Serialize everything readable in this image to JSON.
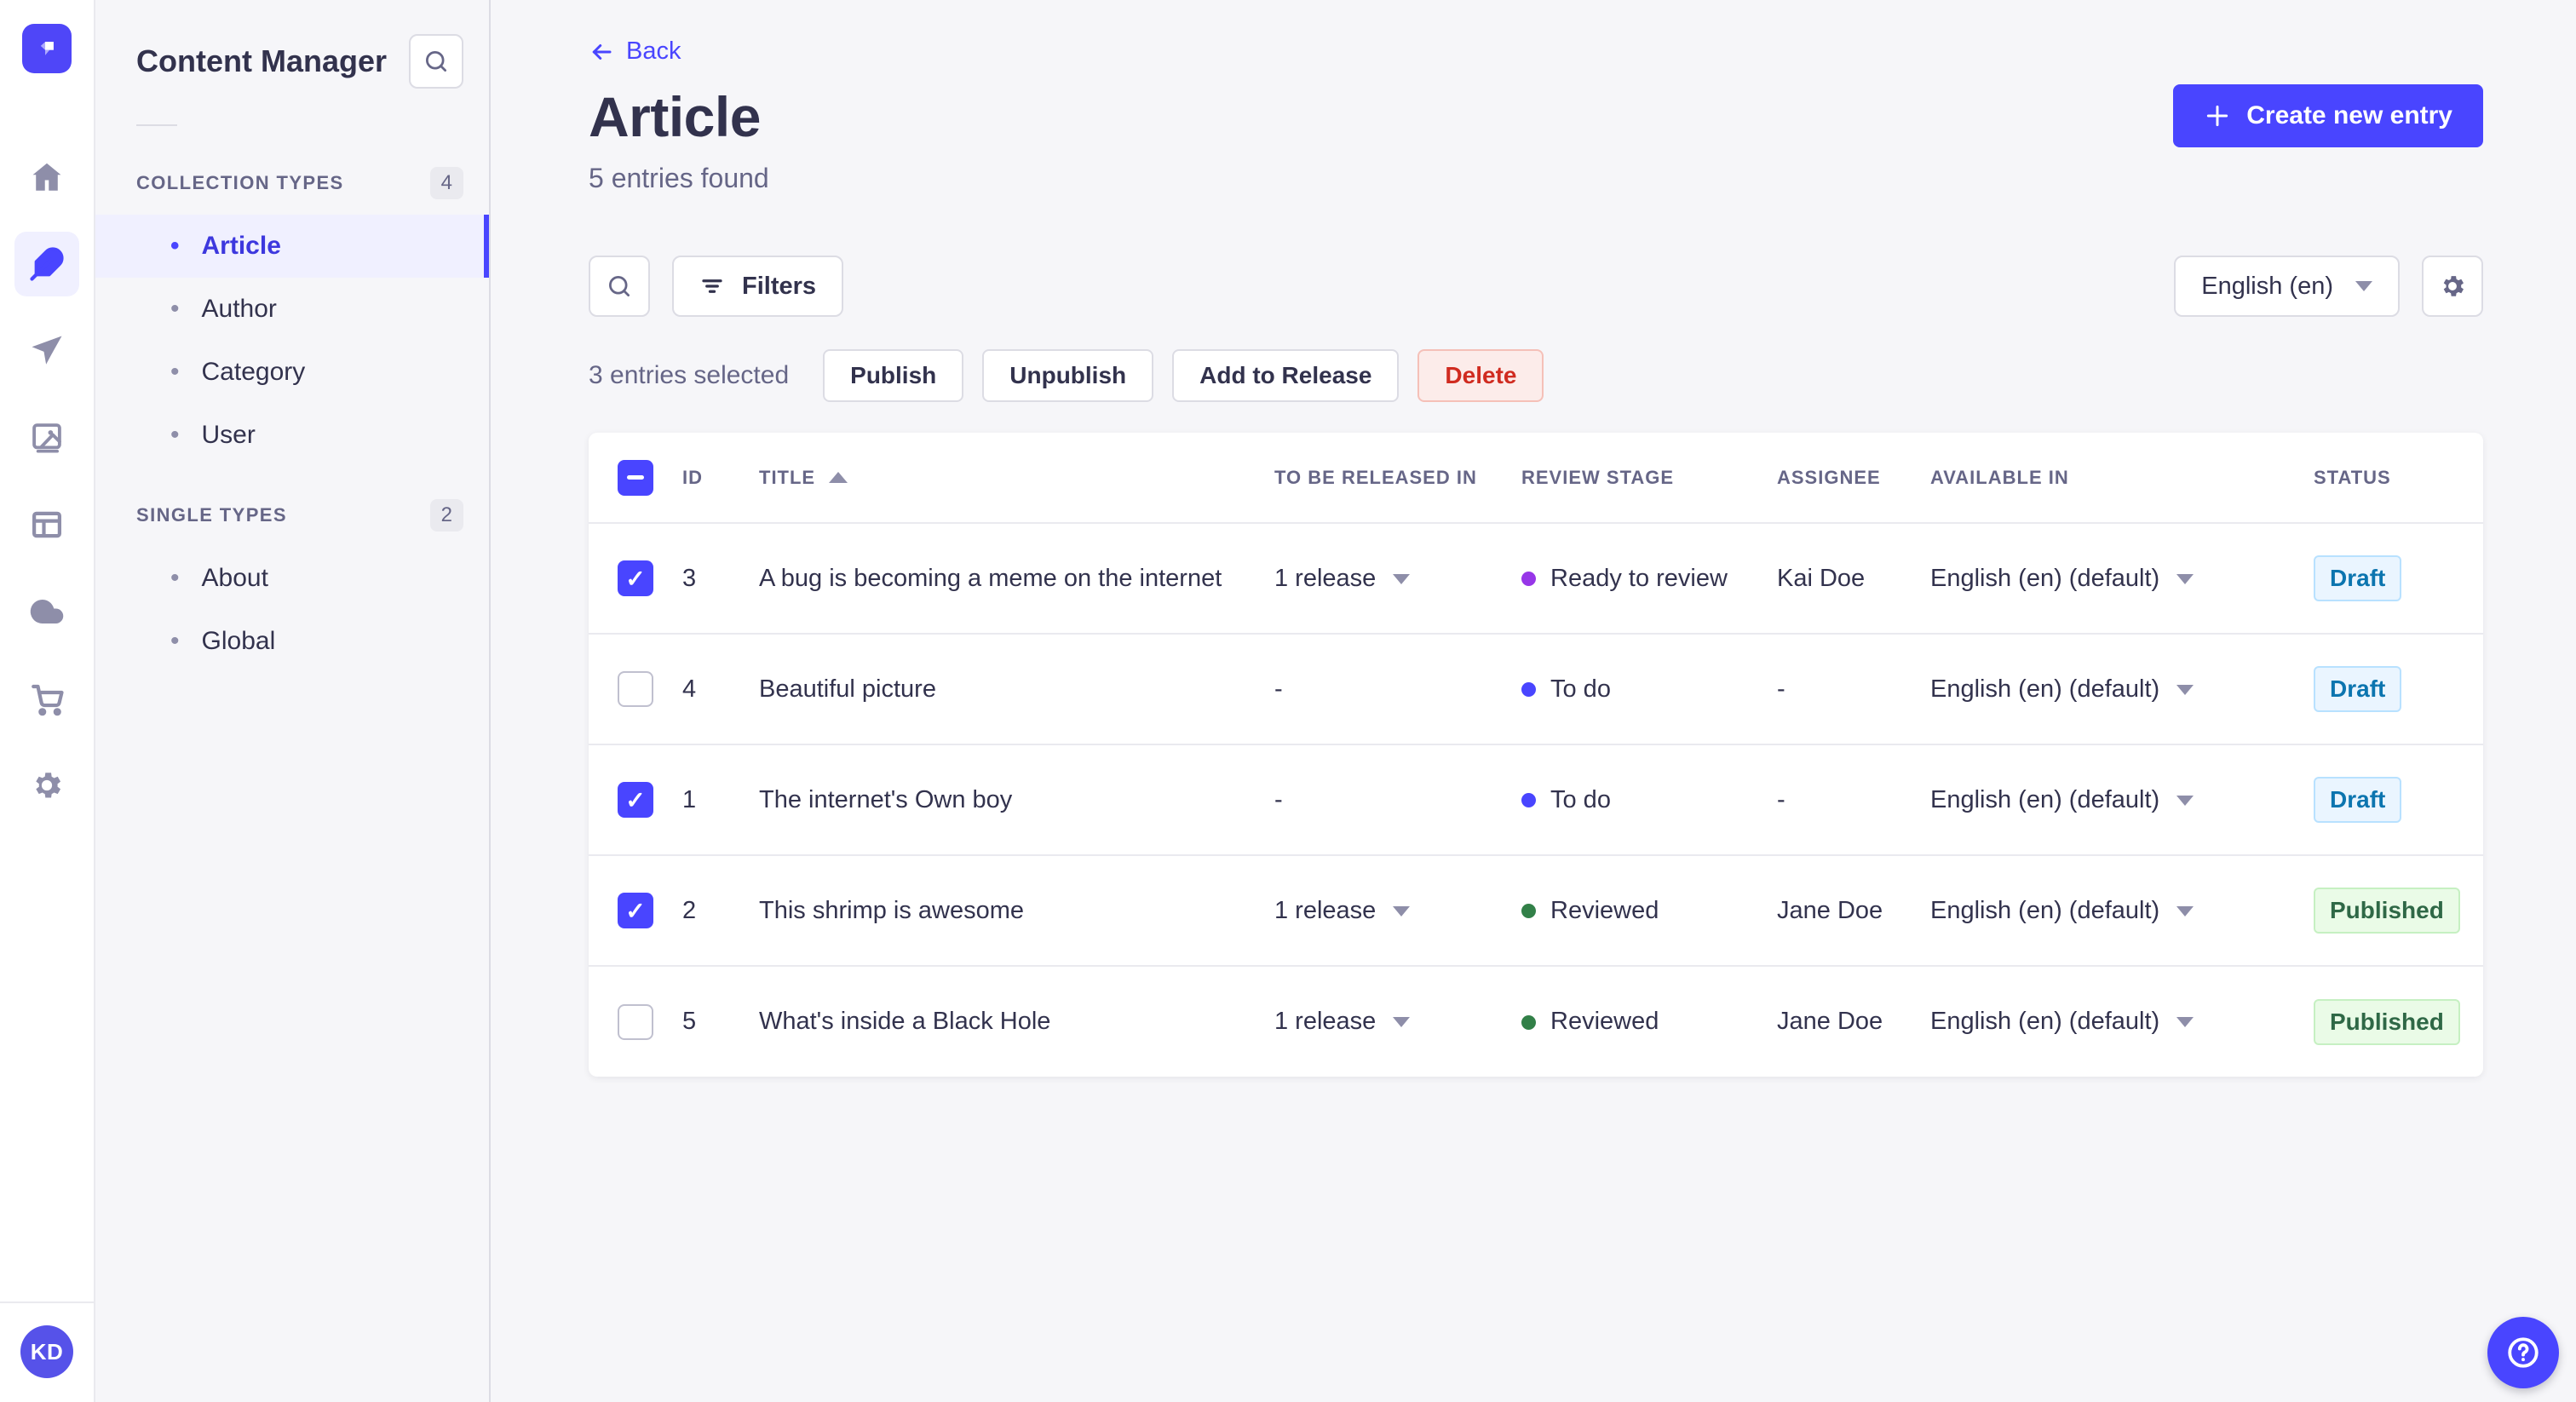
{
  "palette": {
    "accent": "#4945FF",
    "accent_light_bg": "#F0F0FF",
    "text": "#32324D",
    "muted": "#666687",
    "draft_text": "#0C75AF",
    "draft_bg": "#EAF5FF",
    "published_text": "#2F6846",
    "published_bg": "#EAFBE7",
    "danger_text": "#D02B20",
    "danger_bg": "#FCECEA"
  },
  "nav_rail": {
    "icons": [
      "home-icon",
      "content-manager-feather-icon",
      "release-plane-icon",
      "media-library-icon",
      "content-type-builder-icon",
      "cloud-icon",
      "marketplace-cart-icon",
      "settings-gear-icon"
    ],
    "avatar_initials": "KD"
  },
  "sidebar": {
    "title": "Content Manager",
    "sections": [
      {
        "label": "COLLECTION TYPES",
        "count": "4",
        "items": [
          {
            "label": "Article",
            "active": true
          },
          {
            "label": "Author"
          },
          {
            "label": "Category"
          },
          {
            "label": "User"
          }
        ]
      },
      {
        "label": "SINGLE TYPES",
        "count": "2",
        "items": [
          {
            "label": "About"
          },
          {
            "label": "Global"
          }
        ]
      }
    ]
  },
  "header": {
    "back_label": "Back",
    "title": "Article",
    "subtitle": "5 entries found",
    "create_button": "Create new entry"
  },
  "toolbar": {
    "filters_label": "Filters",
    "locale": "English (en)"
  },
  "selection": {
    "text": "3 entries selected",
    "actions": [
      "Publish",
      "Unpublish",
      "Add to Release",
      "Delete"
    ]
  },
  "table": {
    "columns": [
      "ID",
      "TITLE",
      "TO BE RELEASED IN",
      "REVIEW STAGE",
      "ASSIGNEE",
      "AVAILABLE IN",
      "STATUS"
    ],
    "rows": [
      {
        "checked": true,
        "id": "3",
        "title": "A bug is becoming a meme on the internet",
        "release": "1 release",
        "has_release": true,
        "stage": "Ready to review",
        "stage_color": "#9736E8",
        "assignee": "Kai Doe",
        "available": "English (en) (default)",
        "status": "Draft",
        "is_published": false
      },
      {
        "checked": false,
        "id": "4",
        "title": "Beautiful picture",
        "release": "-",
        "has_release": false,
        "stage": "To do",
        "stage_color": "#4945FF",
        "assignee": "-",
        "available": "English (en) (default)",
        "status": "Draft",
        "is_published": false
      },
      {
        "checked": true,
        "id": "1",
        "title": "The internet's Own boy",
        "release": "-",
        "has_release": false,
        "stage": "To do",
        "stage_color": "#4945FF",
        "assignee": "-",
        "available": "English (en) (default)",
        "status": "Draft",
        "is_published": false
      },
      {
        "checked": true,
        "id": "2",
        "title": "This shrimp is awesome",
        "release": "1 release",
        "has_release": true,
        "stage": "Reviewed",
        "stage_color": "#328048",
        "assignee": "Jane Doe",
        "available": "English (en) (default)",
        "status": "Published",
        "is_published": true
      },
      {
        "checked": false,
        "id": "5",
        "title": "What's inside a Black Hole",
        "release": "1 release",
        "has_release": true,
        "stage": "Reviewed",
        "stage_color": "#328048",
        "assignee": "Jane Doe",
        "available": "English (en) (default)",
        "status": "Published",
        "is_published": true
      }
    ]
  }
}
